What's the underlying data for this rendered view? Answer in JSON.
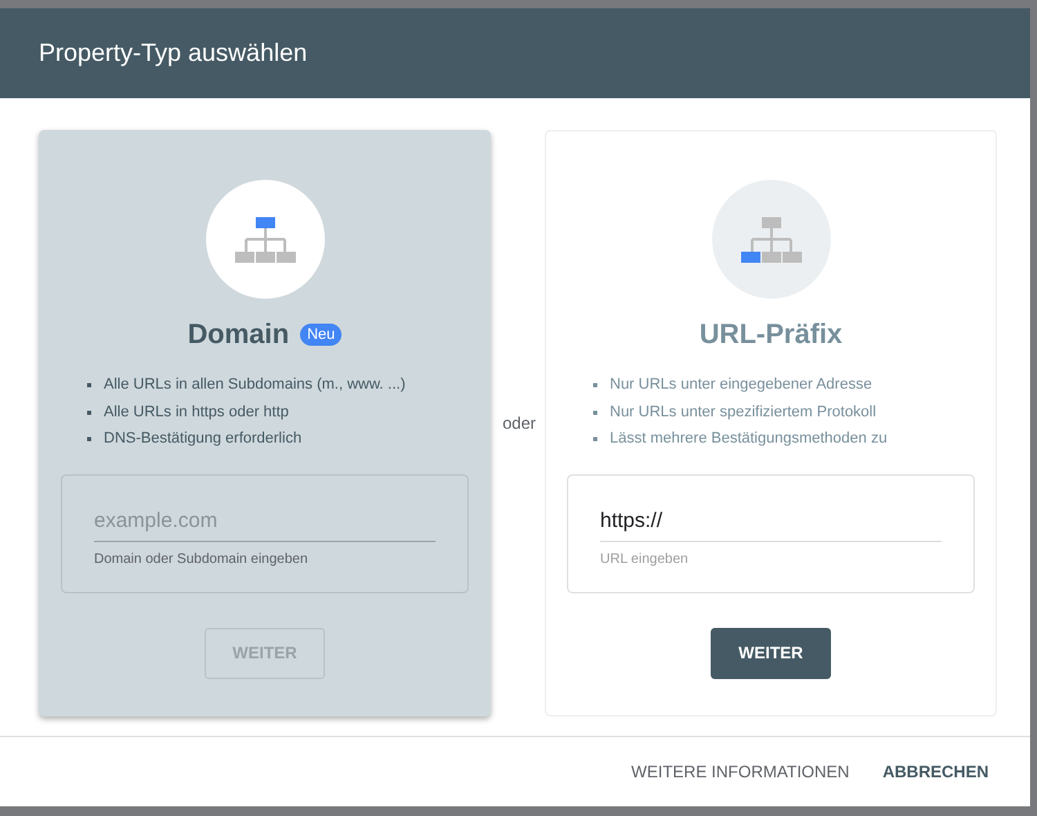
{
  "dialog": {
    "title": "Property-Typ auswählen"
  },
  "options": [
    {
      "selected": true,
      "icon_nodes": [
        {
          "highlighted": true
        },
        {
          "highlighted": false
        },
        {
          "highlighted": false
        },
        {
          "highlighted": false
        }
      ],
      "title": "Domain",
      "badge": "Neu",
      "bullets": [
        "Alle URLs in allen Subdomains (m., www. ...)",
        "Alle URLs in https oder http",
        "DNS-Bestätigung erforderlich"
      ],
      "field": {
        "placeholder": "example.com",
        "helper": "Domain oder Subdomain eingeben"
      },
      "button": {
        "label": "WEITER",
        "disabled": true
      }
    },
    {
      "selected": false,
      "icon_nodes": [
        {
          "highlighted": false
        },
        {
          "highlighted": true
        },
        {
          "highlighted": false
        },
        {
          "highlighted": false
        }
      ],
      "title": "URL-Präfix",
      "bullets": [
        "Nur URLs unter eingegebener Adresse",
        "Nur URLs unter spezifiziertem Protokoll",
        "Lässt mehrere Bestätigungsmethoden zu"
      ],
      "field": {
        "value": "https://",
        "helper": "URL eingeben"
      },
      "button": {
        "label": "WEITER",
        "disabled": false
      }
    }
  ],
  "separator": "oder",
  "footer": {
    "buttons": [
      {
        "label": "WEITERE INFORMATIONEN",
        "kind": "secondary"
      },
      {
        "label": "ABBRECHEN",
        "kind": "primary"
      }
    ]
  }
}
